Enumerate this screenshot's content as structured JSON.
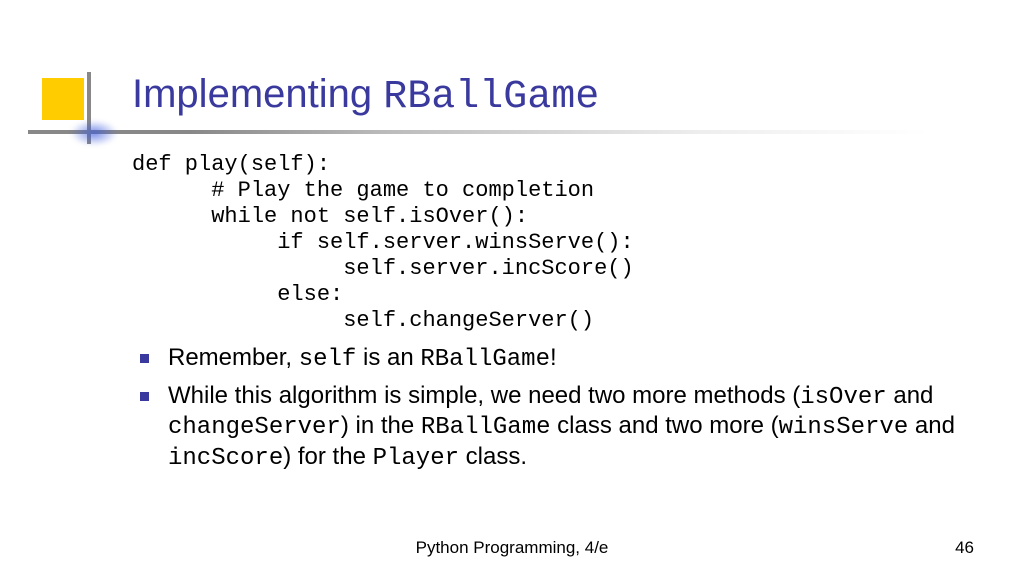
{
  "title": {
    "word1": "Implementing ",
    "word2": "RBallGame"
  },
  "code": "def play(self):\n      # Play the game to completion\n      while not self.isOver():\n           if self.server.winsServe():\n                self.server.incScore()\n           else:\n                self.changeServer()",
  "bullets": [
    {
      "parts": [
        {
          "t": "Remember, ",
          "mono": false
        },
        {
          "t": "self",
          "mono": true
        },
        {
          "t": " is an ",
          "mono": false
        },
        {
          "t": "RBallGame",
          "mono": true
        },
        {
          "t": "!",
          "mono": false
        }
      ]
    },
    {
      "parts": [
        {
          "t": "While this algorithm is simple, we need two more methods (",
          "mono": false
        },
        {
          "t": "isOver",
          "mono": true
        },
        {
          "t": " and ",
          "mono": false
        },
        {
          "t": "changeServer",
          "mono": true
        },
        {
          "t": ") in the ",
          "mono": false
        },
        {
          "t": "RBallGame",
          "mono": true
        },
        {
          "t": " class and two more (",
          "mono": false
        },
        {
          "t": "winsServe",
          "mono": true
        },
        {
          "t": " and ",
          "mono": false
        },
        {
          "t": "incScore",
          "mono": true
        },
        {
          "t": ") for the ",
          "mono": false
        },
        {
          "t": "Player",
          "mono": true
        },
        {
          "t": " class.",
          "mono": false
        }
      ]
    }
  ],
  "footer": {
    "center": "Python Programming, 4/e",
    "page": "46"
  }
}
